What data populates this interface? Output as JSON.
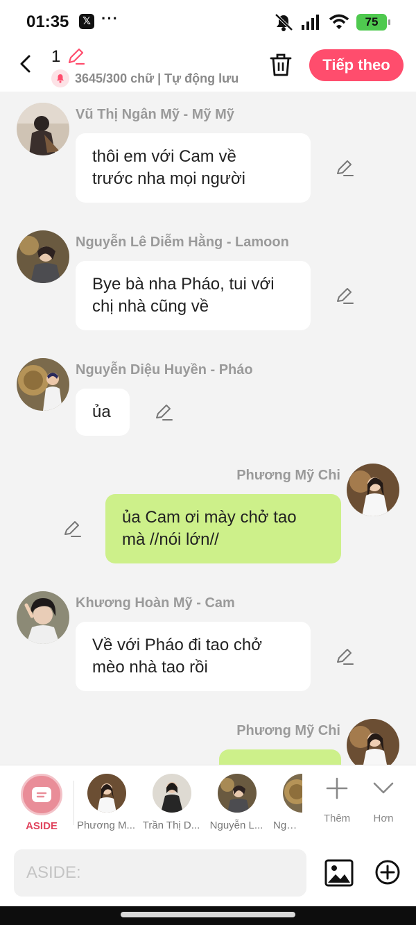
{
  "status_bar": {
    "time": "01:35",
    "x_badge": "𝕏",
    "more": "···",
    "battery": "75"
  },
  "header": {
    "title": "1",
    "subtitle": "3645/300 chữ | Tự động lưu",
    "next_label": "Tiếp theo"
  },
  "messages": [
    {
      "sender": "Vũ Thị Ngân Mỹ - Mỹ Mỹ",
      "side": "left",
      "line1": "thôi em với Cam về",
      "line2": "trước nha mọi người"
    },
    {
      "sender": "Nguyễn Lê Diễm Hằng - Lamoon",
      "side": "left",
      "line1": "Bye bà nha Pháo, tui với",
      "line2": "chị nhà cũng về"
    },
    {
      "sender": "Nguyễn Diệu Huyền - Pháo",
      "side": "left",
      "line1": "ủa",
      "line2": ""
    },
    {
      "sender": "Phương Mỹ Chi",
      "side": "right",
      "line1": "ủa Cam ơi mày chở tao",
      "line2": "mà //nói lớn//"
    },
    {
      "sender": "Khương Hoàn Mỹ - Cam",
      "side": "left",
      "line1": "Về với Pháo đi tao chở",
      "line2": "mèo nhà tao rồi"
    },
    {
      "sender": "Phương Mỹ Chi",
      "side": "right",
      "line1": "",
      "line2": ""
    }
  ],
  "characters": {
    "aside_label": "ASIDE",
    "items": [
      {
        "label": "Phương M..."
      },
      {
        "label": "Trần Thị D..."
      },
      {
        "label": "Nguyễn L..."
      },
      {
        "label": "Nguyễ"
      }
    ],
    "add_label": "Thêm",
    "more_label": "Hơn"
  },
  "input": {
    "placeholder": "ASIDE:"
  },
  "colors": {
    "accent": "#ff4d6d",
    "right_bubble": "#cdf08a",
    "left_bubble": "#ffffff",
    "background": "#f3f3f3"
  }
}
